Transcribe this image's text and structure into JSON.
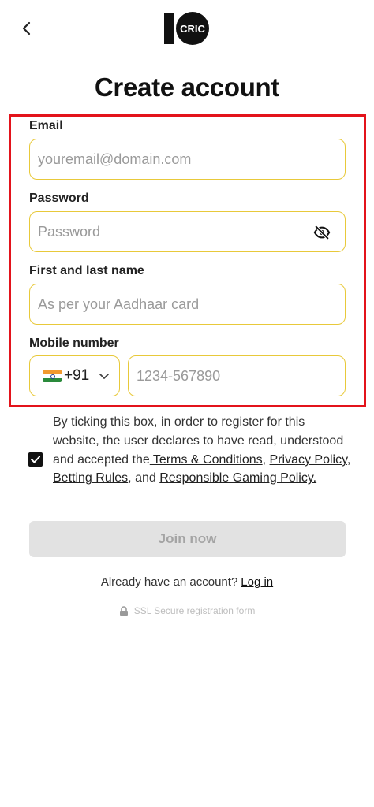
{
  "header": {
    "logo_text": "CRIC",
    "title": "Create account"
  },
  "form": {
    "email": {
      "label": "Email",
      "value": "",
      "placeholder": "youremail@domain.com"
    },
    "password": {
      "label": "Password",
      "value": "",
      "placeholder": "Password"
    },
    "name": {
      "label": "First and last name",
      "value": "",
      "placeholder": "As per your Aadhaar card"
    },
    "mobile": {
      "label": "Mobile number",
      "country_code": "+91",
      "country_flag": "india-flag",
      "value": "",
      "placeholder": "1234-567890"
    }
  },
  "consent": {
    "checked": true,
    "text_1": "By ticking this box, in order to register for this website, the user declares to have read, understood and accepted the",
    "terms_link": " Terms & Conditions",
    "sep_1": ", ",
    "privacy_link": "Privacy Policy",
    "sep_2": ", ",
    "betting_link": "Betting Rules",
    "sep_3": ", and ",
    "responsible_link": "Responsible Gaming Policy."
  },
  "actions": {
    "join_label": "Join now",
    "login_prompt": "Already have an account?",
    "login_link": "Log in"
  },
  "footer": {
    "ssl_text": "SSL Secure registration form"
  },
  "colors": {
    "input_border": "#e8c93a",
    "highlight": "#e3131b",
    "button_disabled": "#e2e2e2"
  }
}
